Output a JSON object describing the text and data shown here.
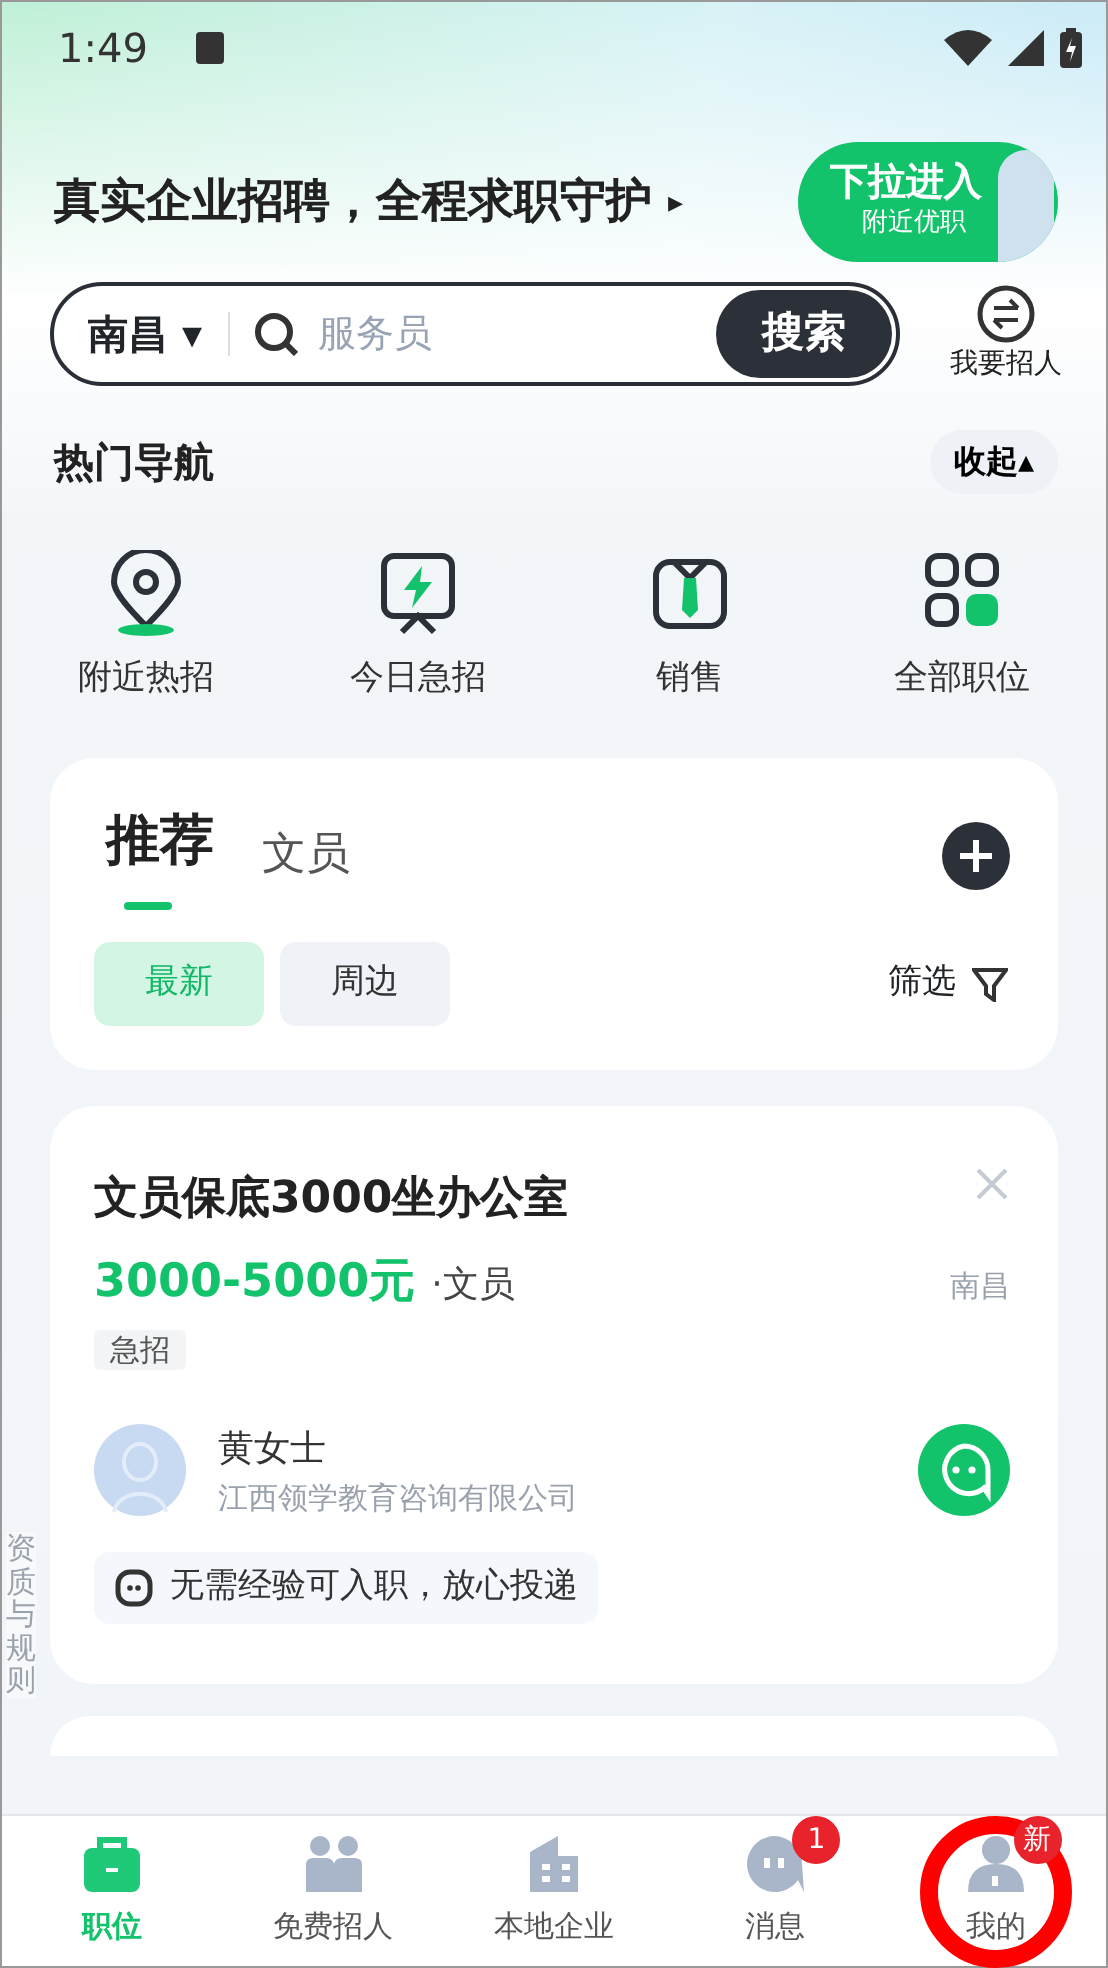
{
  "status_bar": {
    "time": "1:49"
  },
  "banner": {
    "slogan": "真实企业招聘，全程求职守护",
    "arrow": "▸",
    "promo_title": "下拉进入",
    "promo_sub": "附近优职"
  },
  "search": {
    "city": "南昌",
    "caret": "▾",
    "placeholder": "服务员",
    "button": "搜索",
    "recruit_label": "我要招人"
  },
  "hot_nav": {
    "title": "热门导航",
    "toggle": "收起",
    "toggle_caret": "▴",
    "items": [
      {
        "kind": "pin",
        "label": "附近热招"
      },
      {
        "kind": "bolt",
        "label": "今日急招"
      },
      {
        "kind": "shirt",
        "label": "销售"
      },
      {
        "kind": "grid",
        "label": "全部职位"
      }
    ]
  },
  "feed_tabs": {
    "tabs": [
      {
        "label": "推荐",
        "selected": true
      },
      {
        "label": "文员",
        "selected": false
      }
    ],
    "chips": [
      {
        "label": "最新",
        "selected": true
      },
      {
        "label": "周边",
        "selected": false
      }
    ],
    "filter": "筛选"
  },
  "job": {
    "title": "文员保底3000坐办公室",
    "salary": "3000-5000元",
    "category": "·文员",
    "city": "南昌",
    "tag": "急招",
    "recruiter": "黄女士",
    "company": "江西领学教育咨询有限公司",
    "note": "无需经验可入职，放心投递"
  },
  "side_tab": "资质与规则",
  "bottom_nav": [
    {
      "kind": "job",
      "label": "职位",
      "selected": true
    },
    {
      "kind": "people",
      "label": "免费招人",
      "selected": false
    },
    {
      "kind": "building",
      "label": "本地企业",
      "selected": false
    },
    {
      "kind": "chat",
      "label": "消息",
      "selected": false,
      "badge": "1"
    },
    {
      "kind": "me",
      "label": "我的",
      "selected": false,
      "badge": "新"
    }
  ]
}
